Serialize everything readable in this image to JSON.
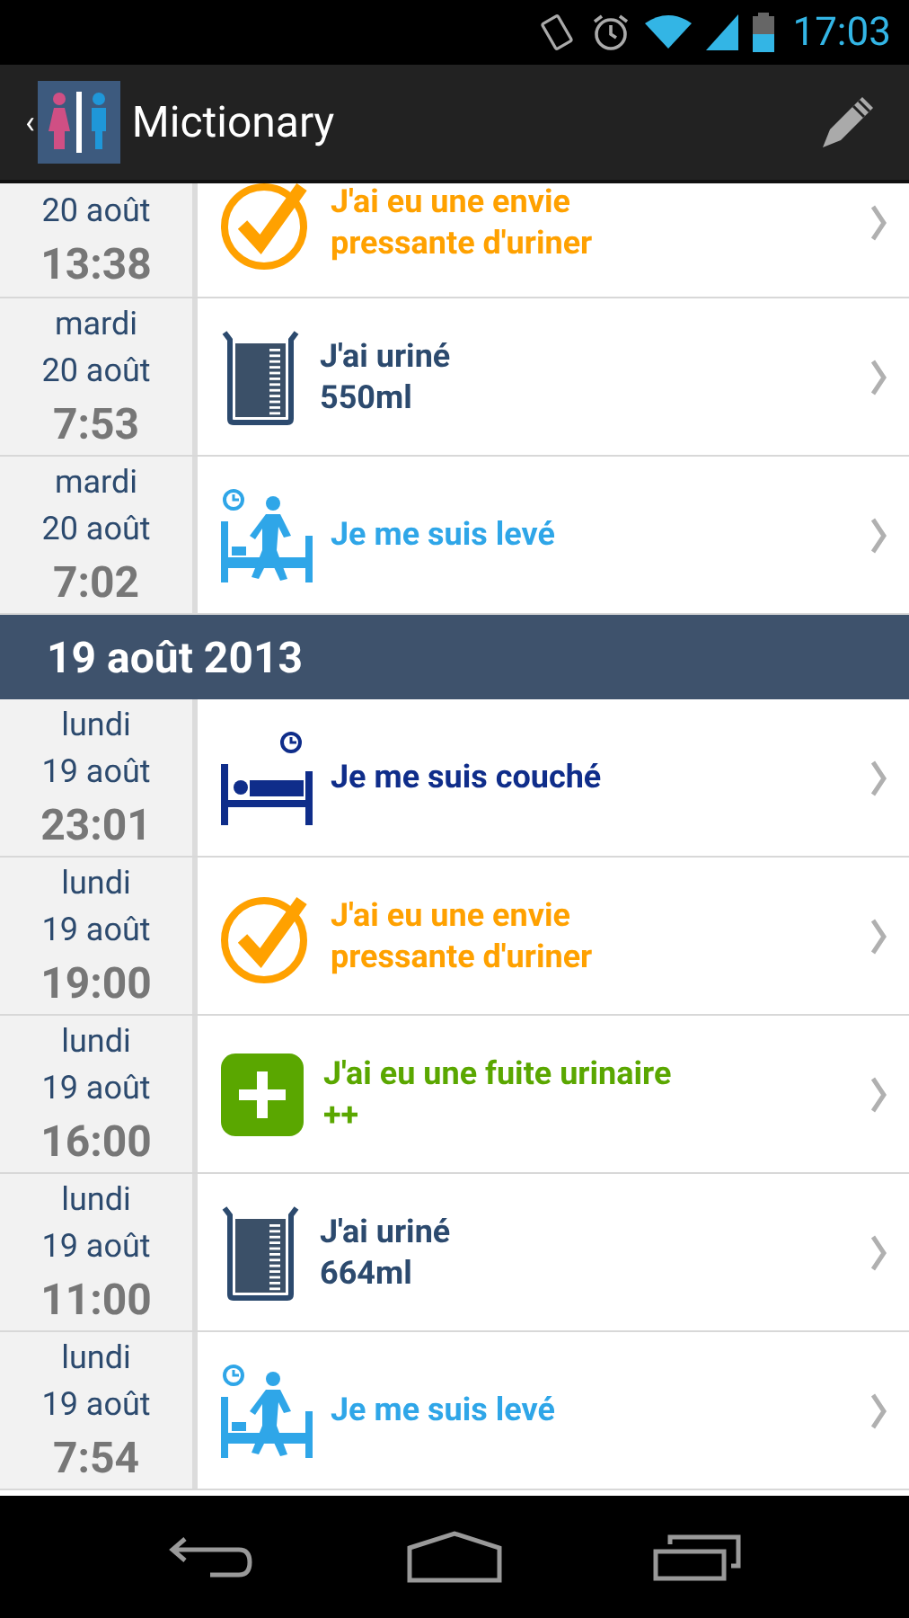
{
  "status_bar": {
    "time": "17:03"
  },
  "action_bar": {
    "back": "‹",
    "title": "Mictionary"
  },
  "entries": [
    {
      "kind": "urge",
      "date": "20 août",
      "time": "13:38",
      "title": "J'ai eu une envie pressante d'uriner",
      "clipped": true
    },
    {
      "kind": "urinated",
      "day": "mardi",
      "date": "20 août",
      "time": "7:53",
      "title": "J'ai uriné",
      "detail": "550ml"
    },
    {
      "kind": "woke",
      "day": "mardi",
      "date": "20 août",
      "time": "7:02",
      "title": "Je me suis levé"
    },
    {
      "kind": "header",
      "label": "19 août 2013"
    },
    {
      "kind": "slept",
      "day": "lundi",
      "date": "19 août",
      "time": "23:01",
      "title": "Je me suis couché"
    },
    {
      "kind": "urge",
      "day": "lundi",
      "date": "19 août",
      "time": "19:00",
      "title": "J'ai eu une envie pressante d'uriner"
    },
    {
      "kind": "leak",
      "day": "lundi",
      "date": "19 août",
      "time": "16:00",
      "title": "J'ai eu une fuite urinaire",
      "detail": "++"
    },
    {
      "kind": "urinated",
      "day": "lundi",
      "date": "19 août",
      "time": "11:00",
      "title": "J'ai uriné",
      "detail": "664ml"
    },
    {
      "kind": "woke",
      "day": "lundi",
      "date": "19 août",
      "time": "7:54",
      "title": "Je me suis levé"
    }
  ]
}
